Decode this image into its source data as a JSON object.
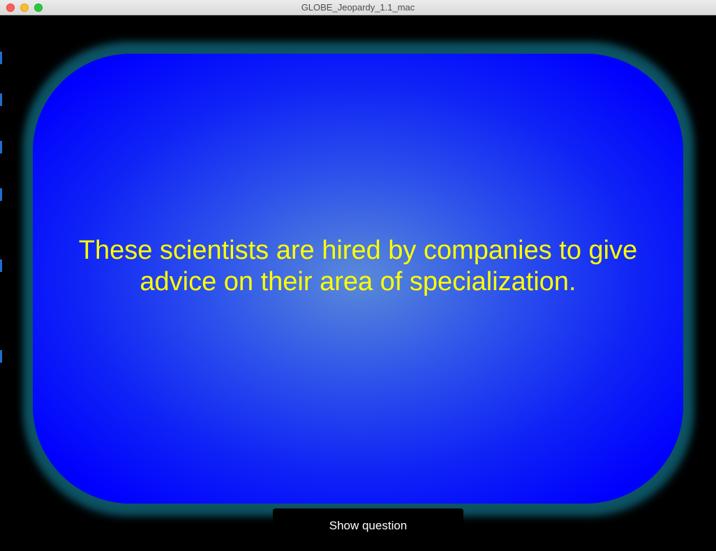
{
  "window": {
    "title": "GLOBE_Jeopardy_1.1_mac"
  },
  "clue": {
    "text": "These scientists are hired by companies to give advice on their area of specialization."
  },
  "controls": {
    "show_question_label": "Show question"
  },
  "colors": {
    "clue_text": "#ffff00",
    "card_blue": "#0000fe",
    "card_center": "#5a8ad8",
    "glow": "#0e5566",
    "background": "#000000"
  }
}
